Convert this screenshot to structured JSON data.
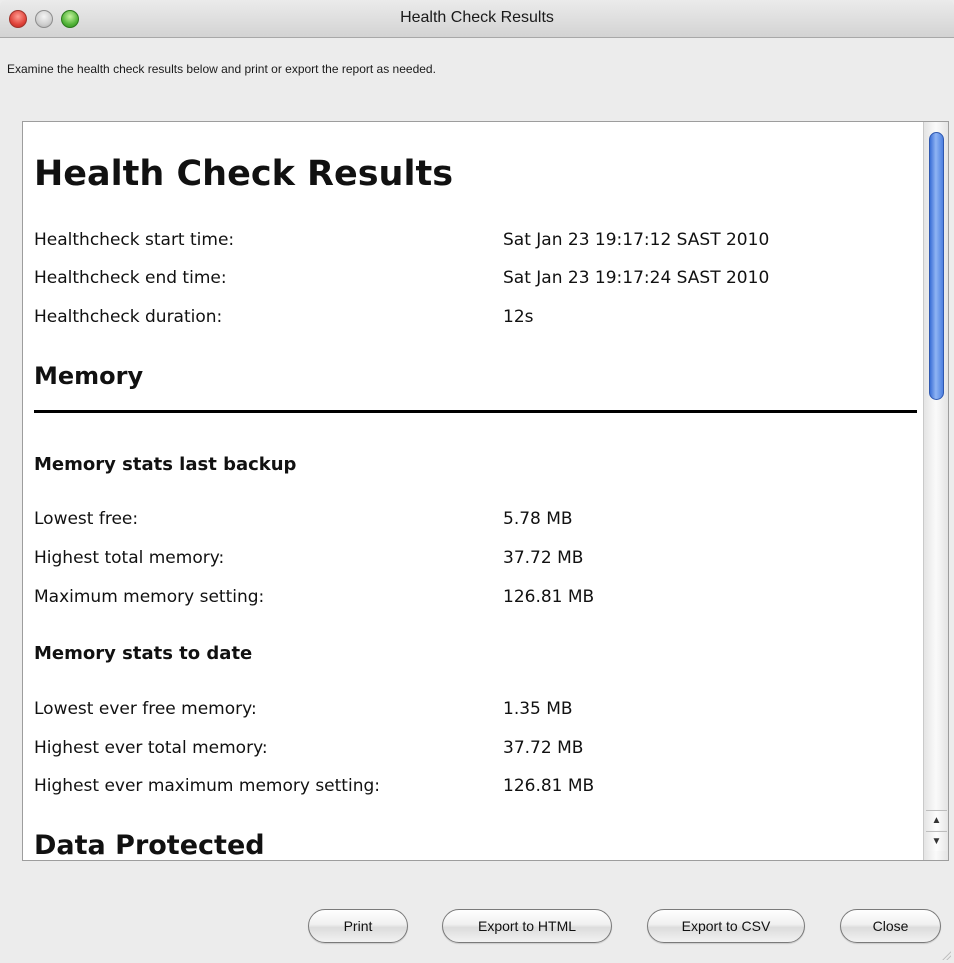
{
  "window": {
    "title": "Health Check Results"
  },
  "instructions": "Examine the health check results below and print or export the report as needed.",
  "report": {
    "heading": "Health Check Results",
    "summary": [
      {
        "label": "Healthcheck start time:",
        "value": "Sat Jan 23 19:17:12 SAST 2010"
      },
      {
        "label": "Healthcheck end time:",
        "value": "Sat Jan 23 19:17:24 SAST 2010"
      },
      {
        "label": "Healthcheck duration:",
        "value": "12s"
      }
    ],
    "memory": {
      "heading": "Memory",
      "last_backup": {
        "heading": "Memory stats last backup",
        "rows": [
          {
            "label": "Lowest free:",
            "value": "5.78 MB"
          },
          {
            "label": "Highest total memory:",
            "value": "37.72 MB"
          },
          {
            "label": "Maximum memory setting:",
            "value": "126.81 MB"
          }
        ]
      },
      "to_date": {
        "heading": "Memory stats to date",
        "rows": [
          {
            "label": "Lowest ever free memory:",
            "value": "1.35 MB"
          },
          {
            "label": "Highest ever total memory:",
            "value": "37.72 MB"
          },
          {
            "label": "Highest ever maximum memory setting:",
            "value": "126.81 MB"
          }
        ]
      }
    },
    "data_protected": {
      "heading": "Data Protected"
    }
  },
  "scrollbar": {
    "up_glyph": "▲",
    "down_glyph": "▼"
  },
  "buttons": {
    "print": "Print",
    "export_html": "Export to HTML",
    "export_csv": "Export to CSV",
    "close": "Close"
  }
}
